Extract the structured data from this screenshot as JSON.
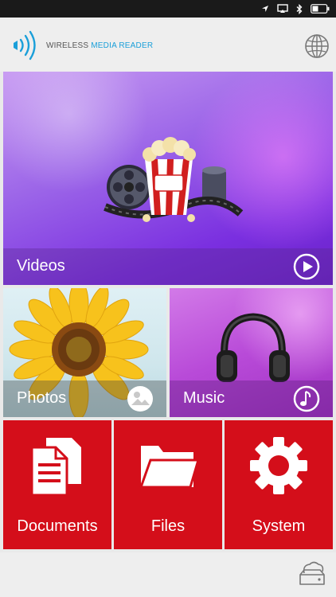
{
  "app": {
    "title_part1": "WIRELESS",
    "title_part2": "MEDIA READER"
  },
  "icons": {
    "wifi": "wifi-signal-icon",
    "globe": "globe-icon",
    "cloud": "cloud-storage-icon",
    "status": [
      "location-arrow-icon",
      "airplay-icon",
      "bluetooth-icon",
      "battery-icon"
    ]
  },
  "tiles": {
    "videos": {
      "label": "Videos",
      "icon": "play-icon"
    },
    "photos": {
      "label": "Photos",
      "icon": "gallery-icon"
    },
    "music": {
      "label": "Music",
      "icon": "music-note-icon"
    },
    "documents": {
      "label": "Documents",
      "icon": "documents-icon"
    },
    "files": {
      "label": "Files",
      "icon": "folder-icon"
    },
    "system": {
      "label": "System",
      "icon": "gear-icon"
    }
  },
  "colors": {
    "accent_blue": "#1a9fd9",
    "tile_red": "#d40e1a",
    "status_bar": "#1a1a1a"
  }
}
